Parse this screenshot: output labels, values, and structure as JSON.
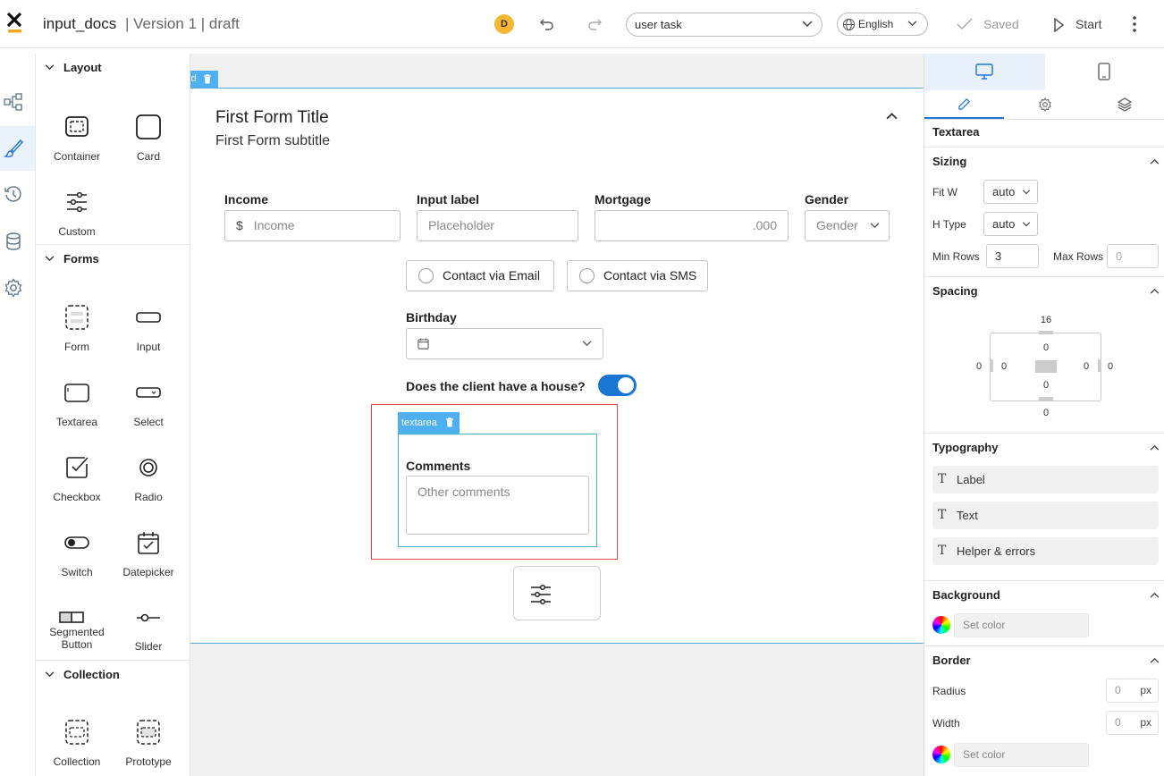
{
  "header": {
    "app_name": "input_docs",
    "version": "| Version 1 | draft",
    "avatar_initial": "D",
    "task_select": "user task",
    "language": "English",
    "saved_label": "Saved",
    "start_label": "Start"
  },
  "palette": {
    "layout": {
      "title": "Layout",
      "items": [
        {
          "label": "Container",
          "icon": "container-icon"
        },
        {
          "label": "Card",
          "icon": "card-icon"
        },
        {
          "label": "Custom",
          "icon": "sliders-icon"
        }
      ]
    },
    "forms": {
      "title": "Forms",
      "items": [
        {
          "label": "Form",
          "icon": "form-icon"
        },
        {
          "label": "Input",
          "icon": "input-icon"
        },
        {
          "label": "Textarea",
          "icon": "textarea-icon"
        },
        {
          "label": "Select",
          "icon": "select-icon"
        },
        {
          "label": "Checkbox",
          "icon": "checkbox-icon"
        },
        {
          "label": "Radio",
          "icon": "radio-icon"
        },
        {
          "label": "Switch",
          "icon": "switch-icon"
        },
        {
          "label": "Datepicker",
          "icon": "datepicker-icon"
        },
        {
          "label": "Segmented\nButton",
          "icon": "segmented-button-icon"
        },
        {
          "label": "Slider",
          "icon": "slider-icon"
        }
      ]
    },
    "collection": {
      "title": "Collection",
      "items": [
        {
          "label": "Collection",
          "icon": "collection-icon"
        },
        {
          "label": "Prototype",
          "icon": "prototype-icon"
        }
      ]
    }
  },
  "canvas": {
    "card_tag": "rd",
    "form_title": "First Form Title",
    "form_subtitle": "First Form subtitle",
    "fields": {
      "income": {
        "label": "Income",
        "prefix": "$",
        "placeholder": "Income"
      },
      "input": {
        "label": "Input label",
        "placeholder": "Placeholder"
      },
      "mortgage": {
        "label": "Mortgage",
        "placeholder": ".000"
      },
      "gender": {
        "label": "Gender",
        "placeholder": "Gender"
      },
      "contact_email": "Contact via Email",
      "contact_sms": "Contact via SMS",
      "birthday": {
        "label": "Birthday"
      },
      "house": {
        "label": "Does the client have a house?",
        "value": true
      },
      "textarea_tag": "textarea",
      "comments": {
        "label": "Comments",
        "placeholder": "Other comments"
      }
    }
  },
  "properties": {
    "component": "Textarea",
    "sizing": {
      "title": "Sizing",
      "fit_w_label": "Fit W",
      "fit_w": "auto",
      "h_type_label": "H Type",
      "h_type": "auto",
      "min_rows_label": "Min Rows",
      "min_rows": "3",
      "max_rows_label": "Max Rows",
      "max_rows": "0"
    },
    "spacing": {
      "title": "Spacing",
      "margin_top": "16",
      "margin_bottom": "0",
      "margin_left": "0",
      "margin_right": "0",
      "padding_top": "0",
      "padding_bottom": "0",
      "padding_left": "0",
      "padding_right": "0"
    },
    "typography": {
      "title": "Typography",
      "items": [
        "Label",
        "Text",
        "Helper & errors"
      ]
    },
    "background": {
      "title": "Background",
      "color_placeholder": "Set color"
    },
    "border": {
      "title": "Border",
      "radius_label": "Radius",
      "radius": "0",
      "width_label": "Width",
      "width": "0",
      "unit": "px",
      "color_placeholder": "Set color"
    }
  },
  "colors": {
    "accent": "#1676d2",
    "tag": "#4fb0f0",
    "selection": "#e04343",
    "avatar": "#f5b731"
  }
}
